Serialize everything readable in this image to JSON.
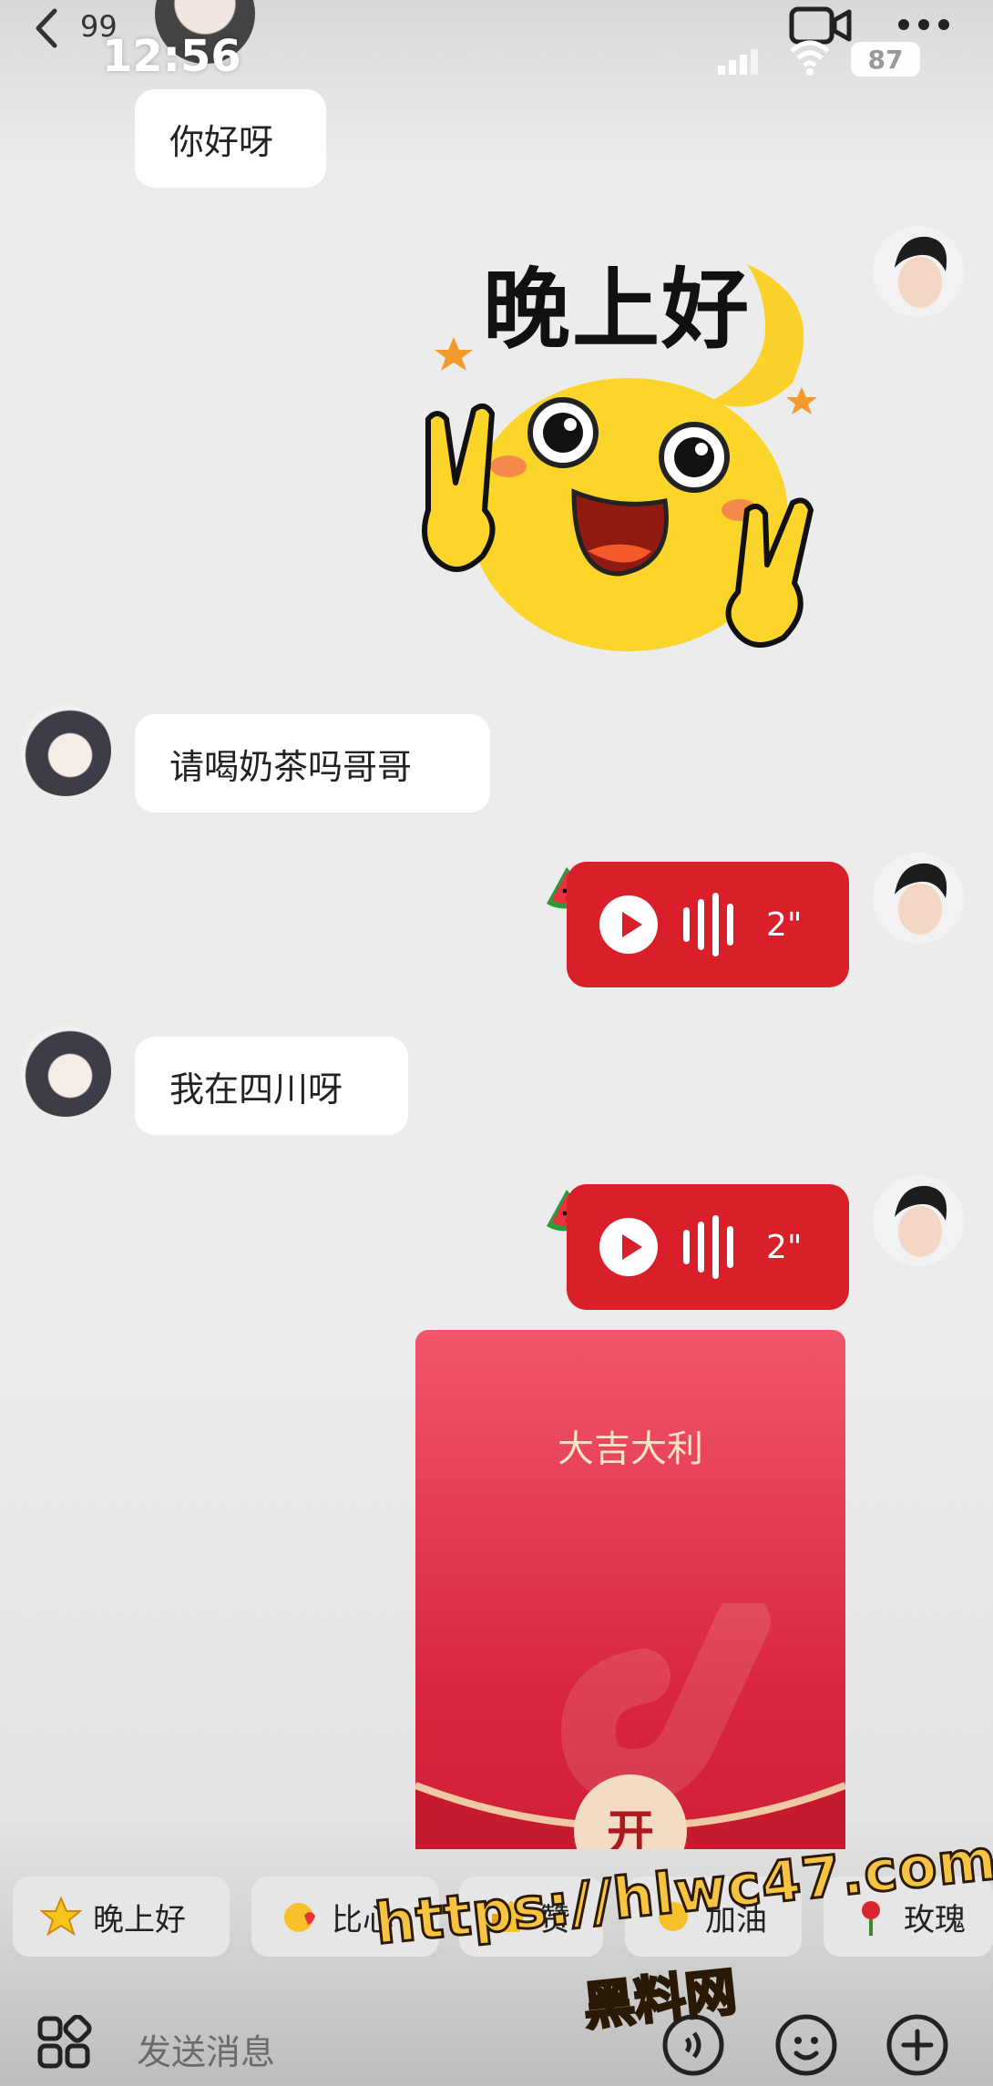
{
  "status_bar": {
    "time": "12:56",
    "battery": "87"
  },
  "header": {
    "unread_count": "99"
  },
  "messages": {
    "m1_text": "你好呀",
    "sticker_text": "晚上好",
    "m3_text": "请喝奶茶吗哥哥",
    "m4_voice_duration": "2\"",
    "m5_text": "我在四川呀",
    "m6_voice_duration": "2\""
  },
  "red_packet": {
    "title": "大吉大利",
    "open_label": "开"
  },
  "quick_replies": [
    {
      "label": "晚上好",
      "icon": "star-icon"
    },
    {
      "label": "比心",
      "icon": "heart-hands-icon"
    },
    {
      "label": "赞",
      "icon": "thumbs-up-icon"
    },
    {
      "label": "加油",
      "icon": "cheer-icon"
    },
    {
      "label": "玫瑰",
      "icon": "rose-icon"
    }
  ],
  "input": {
    "placeholder": "发送消息"
  },
  "watermark": {
    "line1": "https://hlwc47.com",
    "line2": "黑料网"
  },
  "colors": {
    "accent_red": "#d81f2a",
    "bubble_bg": "#ffffff",
    "page_bg": "#ececec"
  }
}
